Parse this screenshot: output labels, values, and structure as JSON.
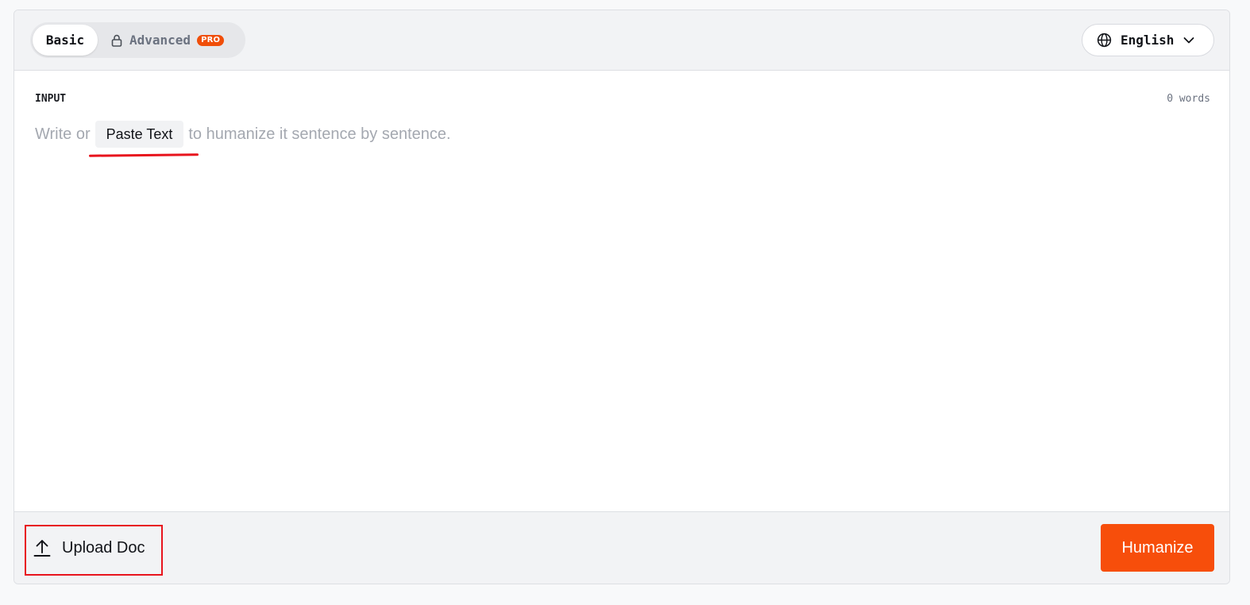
{
  "colors": {
    "accent": "#f74e0b",
    "pro_badge": "#f04e09",
    "annotation_red": "#e8141d"
  },
  "mode_toggle": {
    "basic_label": "Basic",
    "advanced_label": "Advanced",
    "pro_badge": "PRO",
    "active": "Basic"
  },
  "language": {
    "selected": "English",
    "icon": "globe-icon"
  },
  "input": {
    "label": "INPUT",
    "word_count": "0 words",
    "placeholder_before": "Write or",
    "paste_button_label": "Paste Text",
    "placeholder_after": "to humanize it sentence by sentence.",
    "value": ""
  },
  "footer": {
    "upload_label": "Upload Doc",
    "upload_icon": "upload-icon",
    "humanize_label": "Humanize"
  }
}
